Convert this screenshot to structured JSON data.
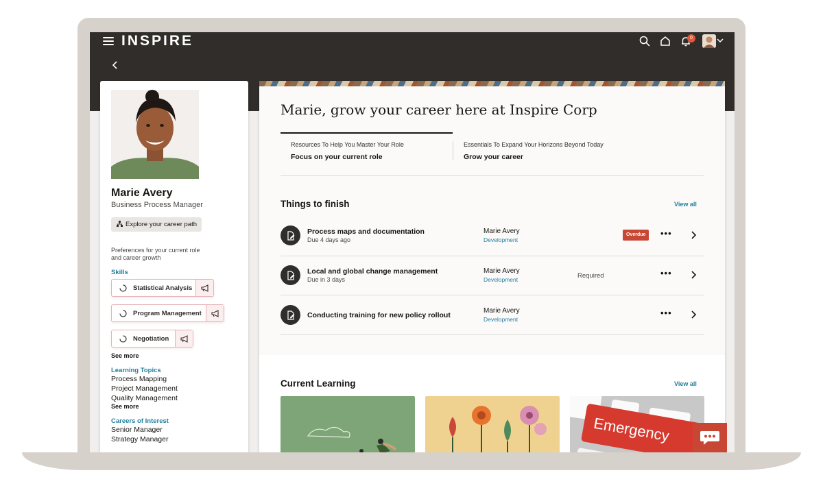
{
  "app": {
    "brand": "INSPIRE",
    "notification_count": "0"
  },
  "profile": {
    "name": "Marie Avery",
    "role": "Business Process Manager",
    "career_button": "Explore your career path",
    "preferences_text": "Preferences for your current role and career growth",
    "skills_label": "Skills",
    "skills": [
      "Statistical Analysis",
      "Program Management",
      "Negotiation"
    ],
    "skills_see_more": "See more",
    "learning_topics_label": "Learning Topics",
    "learning_topics": [
      "Process Mapping",
      "Project Management",
      "Quality Management"
    ],
    "topics_see_more": "See more",
    "careers_label": "Careers of Interest",
    "careers": [
      "Senior Manager",
      "Strategy Manager"
    ]
  },
  "main": {
    "hero_title": "Marie, grow your career here at Inspire Corp",
    "tabs": [
      {
        "subtitle": "Resources To Help You Master Your Role",
        "title": "Focus on your current role"
      },
      {
        "subtitle": "Essentials To Expand Your Horizons Beyond Today",
        "title": "Grow your career"
      }
    ],
    "things_to_finish": {
      "title": "Things to finish",
      "view_all": "View all",
      "tasks": [
        {
          "title": "Process maps and documentation",
          "due": "Due 4 days ago",
          "owner": "Marie Avery",
          "dept": "Development",
          "status": "Overdue"
        },
        {
          "title": "Local and global change management",
          "due": "Due in 3 days",
          "owner": "Marie Avery",
          "dept": "Development",
          "status": "Required"
        },
        {
          "title": "Conducting training for new policy rollout",
          "due": "",
          "owner": "Marie Avery",
          "dept": "Development",
          "status": ""
        }
      ],
      "more_glyph": "•••"
    },
    "current_learning": {
      "title": "Current Learning",
      "view_all": "View all",
      "card3_text": "Emergency"
    }
  },
  "colors": {
    "accent": "#227e9e",
    "header": "#312d2a",
    "overdue": "#c74634",
    "chip_border": "#e4b1b6"
  }
}
